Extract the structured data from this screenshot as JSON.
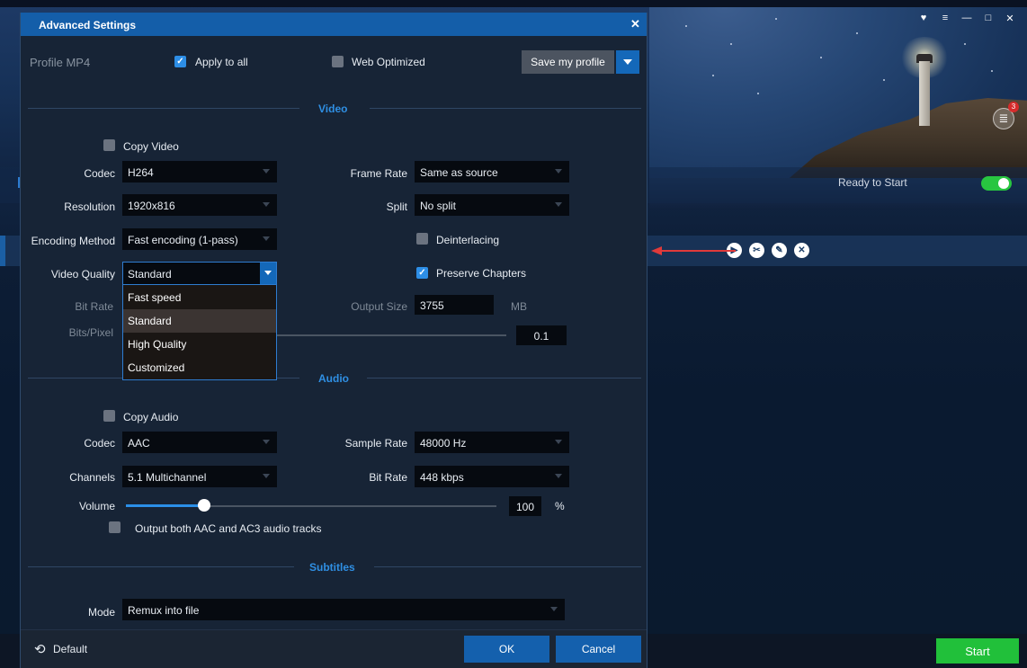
{
  "dialog": {
    "title": "Advanced Settings",
    "close_icon": "close-icon",
    "profile_label": "Profile MP4",
    "apply_to_all": {
      "label": "Apply to all",
      "checked": true
    },
    "web_optimized": {
      "label": "Web Optimized",
      "checked": false
    },
    "save_profile_label": "Save my profile"
  },
  "video": {
    "section_title": "Video",
    "copy_video": {
      "label": "Copy Video",
      "checked": false
    },
    "codec": {
      "label": "Codec",
      "value": "H264"
    },
    "resolution": {
      "label": "Resolution",
      "value": "1920x816"
    },
    "encoding_method": {
      "label": "Encoding Method",
      "value": "Fast encoding (1-pass)"
    },
    "video_quality": {
      "label": "Video Quality",
      "value": "Standard",
      "options": [
        "Fast speed",
        "Standard",
        "High Quality",
        "Customized"
      ]
    },
    "bit_rate_label": "Bit Rate",
    "bits_pixel": {
      "label": "Bits/Pixel",
      "value": "0.1"
    },
    "frame_rate": {
      "label": "Frame Rate",
      "value": "Same as source"
    },
    "split": {
      "label": "Split",
      "value": "No split"
    },
    "deinterlacing": {
      "label": "Deinterlacing",
      "checked": false
    },
    "preserve_chapters": {
      "label": "Preserve Chapters",
      "checked": true
    },
    "output_size": {
      "label": "Output Size",
      "value": "3755",
      "unit": "MB"
    }
  },
  "audio": {
    "section_title": "Audio",
    "copy_audio": {
      "label": "Copy Audio",
      "checked": false
    },
    "codec": {
      "label": "Codec",
      "value": "AAC"
    },
    "channels": {
      "label": "Channels",
      "value": "5.1 Multichannel"
    },
    "sample_rate": {
      "label": "Sample Rate",
      "value": "48000 Hz"
    },
    "bit_rate": {
      "label": "Bit Rate",
      "value": "448 kbps"
    },
    "volume": {
      "label": "Volume",
      "value": "100",
      "unit": "%",
      "level_fraction": 0.21
    },
    "dual_tracks": {
      "label": "Output both AAC and AC3 audio tracks",
      "checked": false
    }
  },
  "subtitles": {
    "section_title": "Subtitles",
    "mode": {
      "label": "Mode",
      "value": "Remux into file"
    }
  },
  "footer": {
    "default_label": "Default",
    "ok_label": "OK",
    "cancel_label": "Cancel"
  },
  "background_app": {
    "status_text": "Ready to Start",
    "queue_badge": "3",
    "start_label": "Start",
    "toggle_on": true
  },
  "colors": {
    "accent_blue": "#1460ad",
    "title_bar": "#145ea9",
    "section_title": "#2f8fe3",
    "start_green": "#21c03a",
    "arrow_red": "#e03a3a"
  }
}
